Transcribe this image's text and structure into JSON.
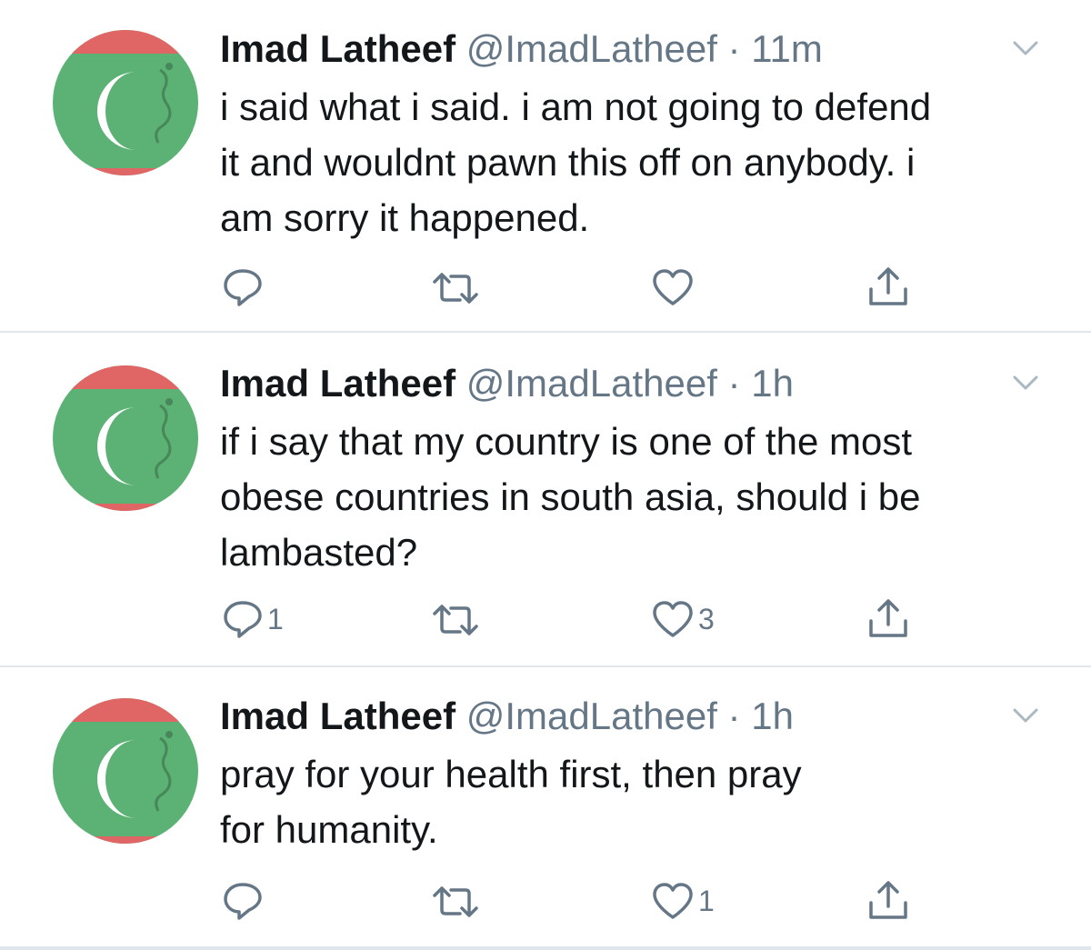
{
  "tweets": [
    {
      "name": "Imad Latheef",
      "handle": "@ImadLatheef",
      "separator": "·",
      "time": "11m",
      "lines": [
        "i said what i said.  i am not going to defend",
        "it and wouldnt pawn this off on anybody. i",
        "am sorry it happened."
      ],
      "reply_count": "",
      "retweet_count": "",
      "like_count": ""
    },
    {
      "name": "Imad Latheef",
      "handle": "@ImadLatheef",
      "separator": "·",
      "time": "1h",
      "lines": [
        "if i say that my country is one of the most",
        "obese countries in south asia, should i be",
        "lambasted?"
      ],
      "reply_count": "1",
      "retweet_count": "",
      "like_count": "3"
    },
    {
      "name": "Imad Latheef",
      "handle": "@ImadLatheef",
      "separator": "·",
      "time": "1h",
      "lines": [
        "pray for your health first, then pray",
        "for humanity."
      ],
      "reply_count": "",
      "retweet_count": "",
      "like_count": "1"
    }
  ],
  "icons": {
    "avatar": "maldives-flag-avatar",
    "reply": "reply-icon",
    "retweet": "retweet-icon",
    "like": "heart-icon",
    "share": "share-icon",
    "menu": "chevron-down-icon"
  },
  "colors": {
    "avatar_red": "#e06666",
    "avatar_green": "#5cb174",
    "icon_gray": "#657786",
    "divider": "#e1e8ed"
  }
}
